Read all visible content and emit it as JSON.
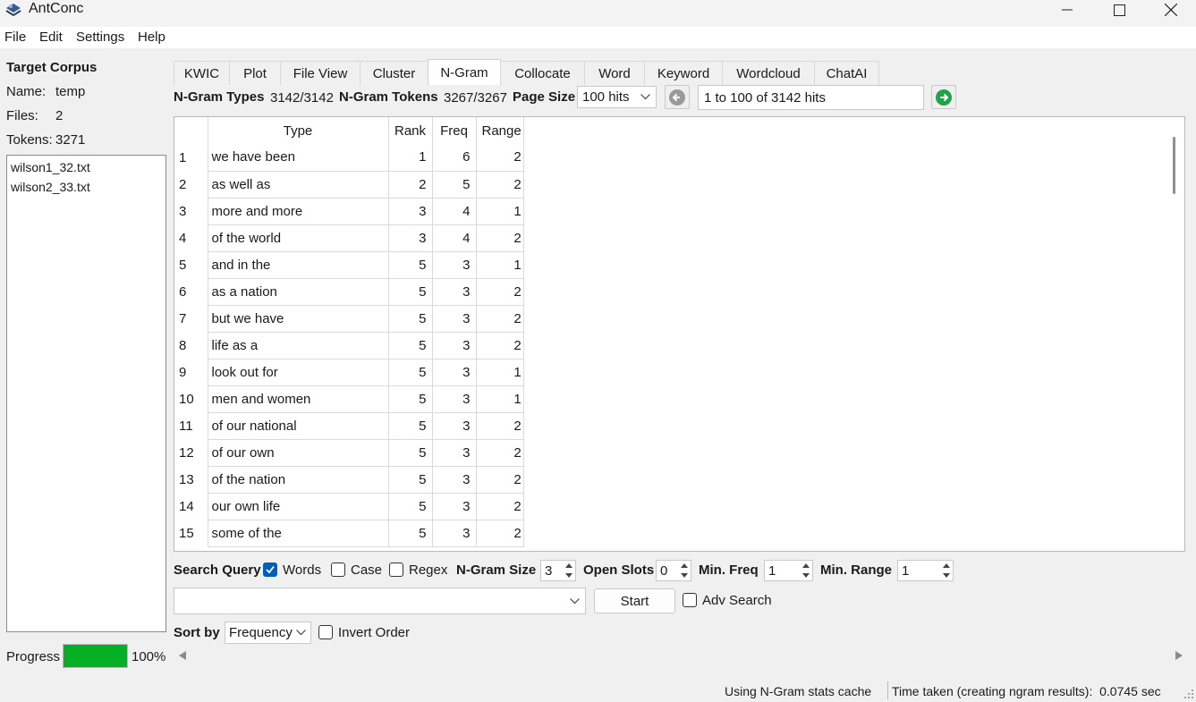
{
  "window": {
    "title": "AntConc"
  },
  "menu": [
    "File",
    "Edit",
    "Settings",
    "Help"
  ],
  "left": {
    "heading": "Target Corpus",
    "name_label": "Name:",
    "name_value": "temp",
    "files_label": "Files:",
    "files_value": "2",
    "tokens_label": "Tokens:",
    "tokens_value": "3271",
    "files": [
      "wilson1_32.txt",
      "wilson2_33.txt"
    ],
    "progress_label": "Progress",
    "progress_value": "100%",
    "progress_fraction": 1.0,
    "progress_color": "#06b025"
  },
  "tabs": [
    "KWIC",
    "Plot",
    "File View",
    "Cluster",
    "N-Gram",
    "Collocate",
    "Word",
    "Keyword",
    "Wordcloud",
    "ChatAI"
  ],
  "active_tab": "N-Gram",
  "stats": {
    "types_label": "N-Gram Types",
    "types_value": "3142/3142",
    "tokens_label": "N-Gram Tokens",
    "tokens_value": "3267/3267",
    "page_size_label": "Page Size",
    "page_size_value": "100 hits",
    "hits_text": "1 to 100 of 3142 hits",
    "prev_icon": "arrow-left-circle-icon",
    "next_icon": "arrow-right-circle-icon"
  },
  "table": {
    "headers": [
      "Type",
      "Rank",
      "Freq",
      "Range"
    ],
    "rows": [
      [
        "1",
        "we have been",
        "1",
        "6",
        "2"
      ],
      [
        "2",
        "as well as",
        "2",
        "5",
        "2"
      ],
      [
        "3",
        "more and more",
        "3",
        "4",
        "1"
      ],
      [
        "4",
        "of the world",
        "3",
        "4",
        "2"
      ],
      [
        "5",
        "and in the",
        "5",
        "3",
        "1"
      ],
      [
        "6",
        "as a nation",
        "5",
        "3",
        "2"
      ],
      [
        "7",
        "but we have",
        "5",
        "3",
        "2"
      ],
      [
        "8",
        "life as a",
        "5",
        "3",
        "2"
      ],
      [
        "9",
        "look out for",
        "5",
        "3",
        "1"
      ],
      [
        "10",
        "men and women",
        "5",
        "3",
        "1"
      ],
      [
        "11",
        "of our national",
        "5",
        "3",
        "2"
      ],
      [
        "12",
        "of our own",
        "5",
        "3",
        "2"
      ],
      [
        "13",
        "of the nation",
        "5",
        "3",
        "2"
      ],
      [
        "14",
        "our own life",
        "5",
        "3",
        "2"
      ],
      [
        "15",
        "some of the",
        "5",
        "3",
        "2"
      ]
    ]
  },
  "query": {
    "label": "Search Query",
    "words_label": "Words",
    "words_checked": true,
    "case_label": "Case",
    "case_checked": false,
    "regex_label": "Regex",
    "regex_checked": false,
    "ngram_size_label": "N-Gram Size",
    "ngram_size_value": "3",
    "open_slots_label": "Open Slots",
    "open_slots_value": "0",
    "min_freq_label": "Min. Freq",
    "min_freq_value": "1",
    "min_range_label": "Min. Range",
    "min_range_value": "1",
    "search_value": "",
    "start_label": "Start",
    "adv_search_label": "Adv Search",
    "adv_search_checked": false
  },
  "sort": {
    "label": "Sort by",
    "value": "Frequency",
    "invert_label": "Invert Order",
    "invert_checked": false
  },
  "status": {
    "left": "Using N-Gram stats cache",
    "right": "Time taken (creating ngram results):  0.0745 sec"
  },
  "colors": {
    "accent": "#005fb8",
    "progress": "#06b025",
    "next_button": "#1fa34a"
  }
}
